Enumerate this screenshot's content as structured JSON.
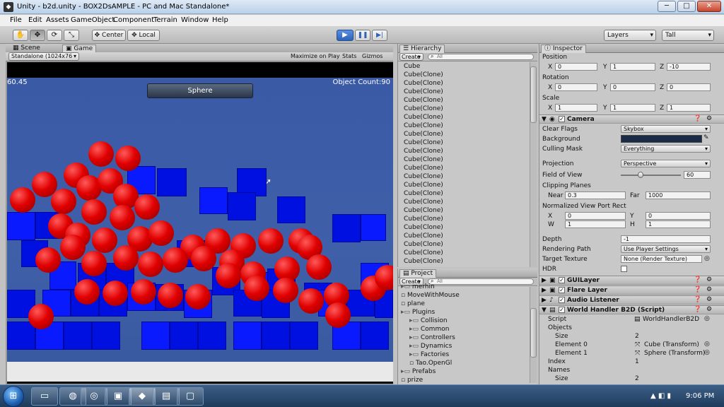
{
  "window": {
    "title": "Unity - b2d.unity - BOX2DsAMPLE - PC and Mac Standalone*"
  },
  "menubar": [
    "File",
    "Edit",
    "Assets",
    "GameObject",
    "Component",
    "Terrain",
    "Window",
    "Help"
  ],
  "toolbar": {
    "pivot_label": "Center",
    "space_label": "Local",
    "layers_label": "Layers",
    "layout_label": "Tall"
  },
  "scene_tabs": {
    "scene": "Scene",
    "game": "Game"
  },
  "game_bar": {
    "resolution": "Standalone (1024x76",
    "maximize": "Maximize on Play",
    "stats": "Stats",
    "gizmos": "Gizmos"
  },
  "game": {
    "fps": "60.45",
    "button": "Sphere",
    "object_count": "Object Count:90"
  },
  "hierarchy": {
    "title": "Hierarchy",
    "create": "Create",
    "search_placeholder": "All",
    "items": [
      "Cube",
      "Cube(Clone)",
      "Cube(Clone)",
      "Cube(Clone)",
      "Cube(Clone)",
      "Cube(Clone)",
      "Cube(Clone)",
      "Cube(Clone)",
      "Cube(Clone)",
      "Cube(Clone)",
      "Cube(Clone)",
      "Cube(Clone)",
      "Cube(Clone)",
      "Cube(Clone)",
      "Cube(Clone)",
      "Cube(Clone)",
      "Cube(Clone)",
      "Cube(Clone)",
      "Cube(Clone)",
      "Cube(Clone)",
      "Cube(Clone)",
      "Cube(Clone)",
      "Cube(Clone)",
      "Cube(Clone)"
    ]
  },
  "project": {
    "title": "Project",
    "create": "Create",
    "search_placeholder": "All",
    "items": [
      {
        "label": "merhin",
        "indent": 0,
        "type": "folder"
      },
      {
        "label": "MoveWithMouse",
        "indent": 0,
        "type": "file"
      },
      {
        "label": "plane",
        "indent": 0,
        "type": "file"
      },
      {
        "label": "Plugins",
        "indent": 0,
        "type": "folder"
      },
      {
        "label": "Collision",
        "indent": 1,
        "type": "folder"
      },
      {
        "label": "Common",
        "indent": 1,
        "type": "folder"
      },
      {
        "label": "Controllers",
        "indent": 1,
        "type": "folder"
      },
      {
        "label": "Dynamics",
        "indent": 1,
        "type": "folder"
      },
      {
        "label": "Factories",
        "indent": 1,
        "type": "folder"
      },
      {
        "label": "Tao.OpenGl",
        "indent": 1,
        "type": "file"
      },
      {
        "label": "Prefabs",
        "indent": 0,
        "type": "folder"
      },
      {
        "label": "prize",
        "indent": 0,
        "type": "file"
      }
    ]
  },
  "inspector": {
    "title": "Inspector",
    "position_label": "Position",
    "rotation_label": "Rotation",
    "scale_label": "Scale",
    "axis_x": "X",
    "axis_y": "Y",
    "axis_z": "Z",
    "position": {
      "x": "0",
      "y": "1",
      "z": "-10"
    },
    "rotation": {
      "x": "0",
      "y": "0",
      "z": "0"
    },
    "scale": {
      "x": "1",
      "y": "1",
      "z": "1"
    },
    "camera": {
      "title": "Camera",
      "clear_flags_label": "Clear Flags",
      "clear_flags": "Skybox",
      "background_label": "Background",
      "background_color": "#1b2a47",
      "culling_mask_label": "Culling Mask",
      "culling_mask": "Everything",
      "projection_label": "Projection",
      "projection": "Perspective",
      "fov_label": "Field of View",
      "fov": "60",
      "fov_fraction": 0.33,
      "clipping_label": "Clipping Planes",
      "near_label": "Near",
      "near": "0.3",
      "far_label": "Far",
      "far": "1000",
      "viewport_label": "Normalized View Port Rect",
      "vp_x_label": "X",
      "vp_x": "0",
      "vp_y_label": "Y",
      "vp_y": "0",
      "vp_w_label": "W",
      "vp_w": "1",
      "vp_h_label": "H",
      "vp_h": "1",
      "depth_label": "Depth",
      "depth": "-1",
      "rendering_path_label": "Rendering Path",
      "rendering_path": "Use Player Settings",
      "target_texture_label": "Target Texture",
      "target_texture": "None (Render Texture)",
      "hdr_label": "HDR"
    },
    "components": [
      "GUILayer",
      "Flare Layer",
      "Audio Listener",
      "World Handler B2D (Script)"
    ],
    "script": {
      "script_label": "Script",
      "script_value": "WorldHandlerB2D",
      "objects_label": "Objects",
      "size_label": "Size",
      "objects_size": "2",
      "element0_label": "Element 0",
      "element0": "Cube (Transform)",
      "element1_label": "Element 1",
      "element1": "Sphere (Transform)",
      "index_label": "Index",
      "index": "1",
      "names_label": "Names",
      "names_size": "2"
    }
  },
  "taskbar": {
    "clock": "9:06 PM"
  },
  "colors": {
    "accent": "#2f62b8",
    "sphere": "#e00000",
    "cube": "#0010e0",
    "sky": "#3f5fa9"
  }
}
